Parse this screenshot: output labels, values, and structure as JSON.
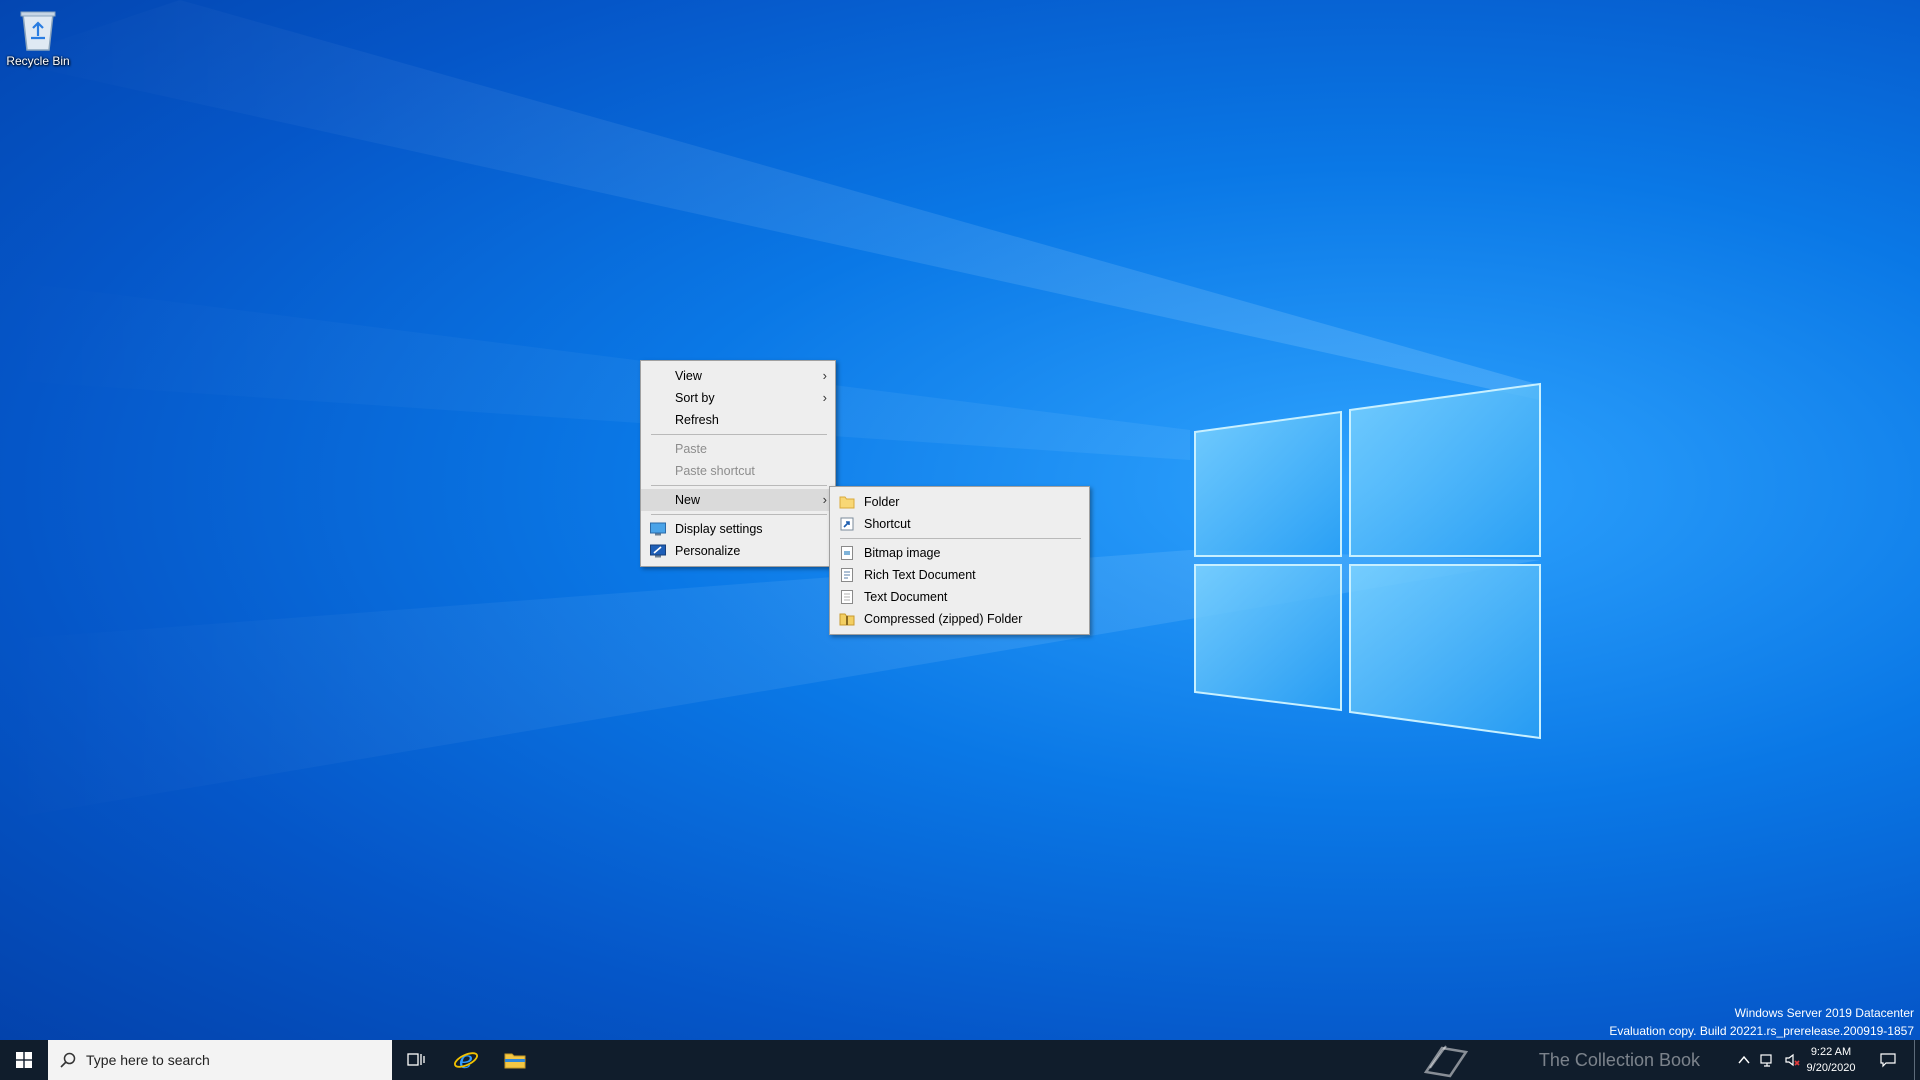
{
  "desktop": {
    "recycle_bin_label": "Recycle Bin"
  },
  "context_menu": {
    "view": "View",
    "sort_by": "Sort by",
    "refresh": "Refresh",
    "paste": "Paste",
    "paste_shortcut": "Paste shortcut",
    "new": "New",
    "display_settings": "Display settings",
    "personalize": "Personalize"
  },
  "new_submenu": {
    "folder": "Folder",
    "shortcut": "Shortcut",
    "bitmap_image": "Bitmap image",
    "rich_text_document": "Rich Text Document",
    "text_document": "Text Document",
    "compressed_folder": "Compressed (zipped) Folder"
  },
  "watermark": {
    "edition": "Windows Server 2019 Datacenter",
    "build": "Evaluation copy. Build 20221.rs_prerelease.200919-1857"
  },
  "taskbar": {
    "search_placeholder": "Type here to search",
    "brand_text": "The Collection Book",
    "time": "9:22 AM",
    "date": "9/20/2020"
  },
  "colors": {
    "taskbar": "#101d2c",
    "menu_background": "#eeeeee",
    "disabled_text": "#8d8d8d"
  }
}
